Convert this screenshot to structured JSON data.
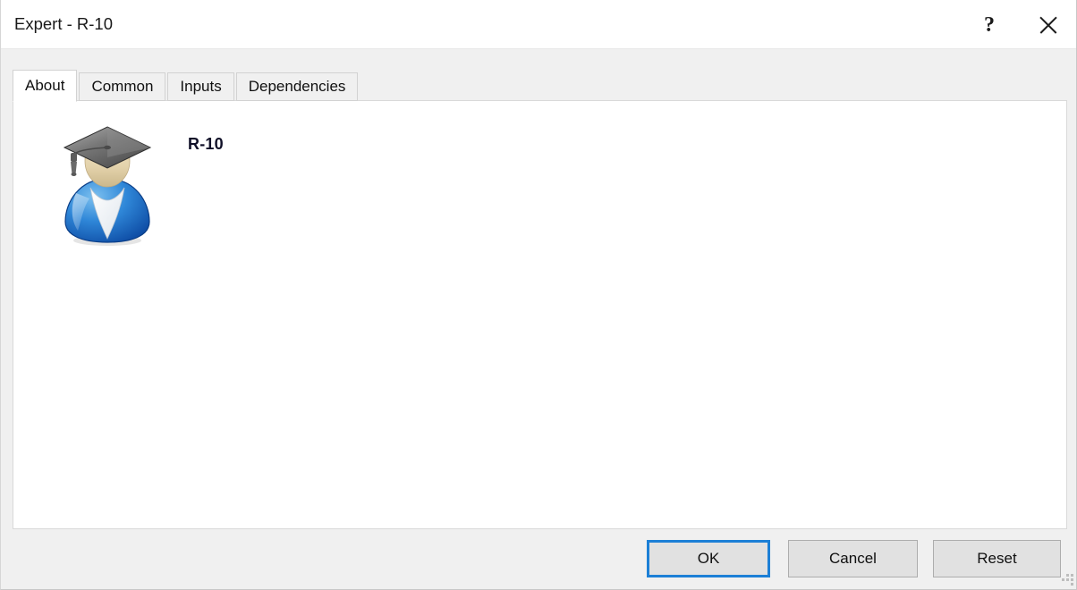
{
  "window": {
    "title": "Expert - R-10",
    "help_label": "?",
    "close_label": "",
    "help_icon": "question-mark-icon",
    "close_icon": "close-x-icon"
  },
  "tabs": [
    {
      "label": "About",
      "active": true
    },
    {
      "label": "Common",
      "active": false
    },
    {
      "label": "Inputs",
      "active": false
    },
    {
      "label": "Dependencies",
      "active": false
    }
  ],
  "about": {
    "icon": "expert-graduate-avatar-icon",
    "product_name": "R-10"
  },
  "footer": {
    "ok_label": "OK",
    "cancel_label": "Cancel",
    "reset_label": "Reset"
  },
  "colors": {
    "dialog_background": "#f0f0f0",
    "content_background": "#ffffff",
    "accent_focus_border": "#1c7fd6",
    "button_face": "#e1e1e1",
    "button_border": "#adadad",
    "text": "#101010"
  }
}
